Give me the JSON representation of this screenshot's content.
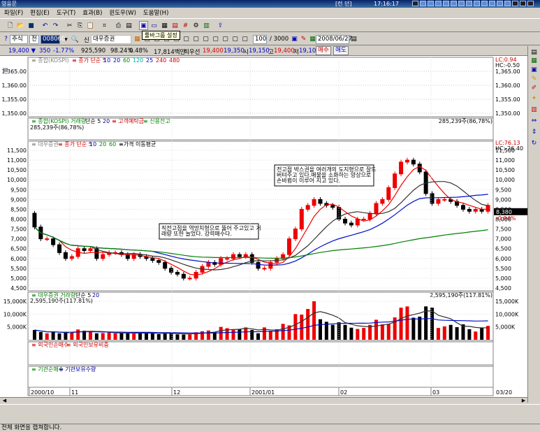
{
  "window": {
    "title": "영웅문",
    "status": "[런 던]",
    "clock": "17:16:17"
  },
  "menu": [
    "파일(F)",
    "편집(E)",
    "도구(T)",
    "효과(B)",
    "윈도우(W)",
    "도움말(H)"
  ],
  "tooltip": "툴바그룹 설정",
  "controls": {
    "market": "주식",
    "period": "전",
    "code": "008060",
    "flag": "신",
    "name": "대우증권",
    "count": "100",
    "total": "/ 3000",
    "date": "2008/06/27"
  },
  "info": {
    "price": "19,400 ▼",
    "change": "350",
    "change_pct": "-1.77%",
    "volume": "925,590",
    "vol_pct": "98.24%",
    "vol_change": "0.48%",
    "amount": "17,814백만",
    "low_label": "최우선",
    "best_bid": "19,400",
    "best_ask": "19,350",
    "open_label": "시",
    "open": "19,150",
    "high_label": "고",
    "high": "19,400",
    "lowp_label": "저",
    "lowp": "19,100",
    "buy": "매수",
    "sell": "매도"
  },
  "panels": {
    "kospi_title_prefix": "종합(KOSPI)",
    "kospi_ma": "종가 단순 5",
    "kospi_ma_periods": [
      "10",
      "20",
      "60",
      "120",
      "25",
      "240",
      "480"
    ],
    "kospi_lc": "LC:0.94",
    "kospi_hc": "HC:-0.50",
    "kospi_ticks": [
      "1,365.00",
      "1,360.00",
      "1,355.00",
      "1,350.00"
    ],
    "kvol_title": "종합(KOSPI) 거래량",
    "kvol_ma": "단순 5",
    "kvol_ma2": "20",
    "kvol_extra1": "고객예탁금",
    "kvol_extra2": "신용잔고",
    "kvol_value_left": "285,239주(86,78%)",
    "kvol_value_right": "285,239주(86,78%)",
    "main_title": "대우증권",
    "main_ma": "종가 단순 5",
    "main_ma_periods": [
      "10",
      "20",
      "60"
    ],
    "main_ma_extra": "가격 이동평균",
    "main_lc": "LC:76.13",
    "main_hc": "HC:-26.40",
    "main_price_box": "8,380",
    "main_price_pct": "-0.94%",
    "note1": "전고점 박스권을 여러개의 도지형으로 잘도 버텨주고 있다.매물을 소화하는 양상으로 손바뀜이 이루어 지고 있다.",
    "note2": "직전고점을 역망치형으로 뚫어 주고있고 거래량 또한 늘었다. 강력매수다.",
    "vol_title": "대우증권 거래량",
    "vol_ma": "단순 5",
    "vol_ma2": "20",
    "vol_value_left": "2,595,190주(117.81%)",
    "vol_value_right": "2,595,190주(117.81%)",
    "foreign_title": "외국인순매수",
    "foreign_title2": "외국인보유비중",
    "inst_title": "기관순매수",
    "inst_title2": "기관보유수량",
    "x_labels": [
      "2000/10",
      "11",
      "12",
      "2001/01",
      "02",
      "03"
    ],
    "last_date": "03/20"
  },
  "chart_data": {
    "type": "candlestick",
    "price_ticks": [
      "11,500",
      "11,000",
      "10,500",
      "10,000",
      "9,500",
      "9,000",
      "8,500",
      "8,000",
      "7,500",
      "7,000",
      "6,500",
      "6,000",
      "5,500",
      "5,000",
      "4,500"
    ],
    "price_range": [
      4500,
      11500
    ],
    "volume_ticks": [
      "15,000K",
      "10,000K",
      "5,000K"
    ],
    "volume_range": [
      0,
      18000
    ],
    "open": [
      8300,
      7600,
      7000,
      7000,
      6700,
      6300,
      6000,
      6100,
      6500,
      6400,
      6500,
      6000,
      6200,
      6300,
      6300,
      6200,
      6000,
      6200,
      6100,
      6000,
      5900,
      5800,
      5500,
      5300,
      5200,
      5000,
      5000,
      5300,
      5600,
      5800,
      5700,
      6000,
      6000,
      6200,
      6100,
      6200,
      5800,
      5500,
      5500,
      5800,
      6000,
      6200,
      7000,
      7500,
      8500,
      8700,
      9000,
      8800,
      8700,
      8600,
      8000,
      7800,
      7700,
      8000,
      8000,
      8300,
      8800,
      9000,
      9600,
      10300,
      10900,
      11000,
      10800,
      10400,
      9300,
      8800,
      9000,
      9000,
      8900,
      8700,
      8500,
      8400,
      8500,
      8400
    ],
    "close": [
      7600,
      7000,
      7000,
      6700,
      6300,
      6000,
      6100,
      6500,
      6400,
      6500,
      6000,
      6200,
      6300,
      6300,
      6200,
      6000,
      6200,
      6100,
      6000,
      5900,
      5800,
      5500,
      5300,
      5200,
      5000,
      5000,
      5300,
      5600,
      5800,
      5700,
      6000,
      6000,
      6200,
      6100,
      6200,
      5800,
      5500,
      5500,
      5800,
      6000,
      6200,
      7000,
      7500,
      8500,
      8700,
      9000,
      8800,
      8700,
      8600,
      8000,
      7800,
      7700,
      8000,
      8000,
      8300,
      8800,
      9000,
      9600,
      10300,
      10900,
      11000,
      10800,
      10400,
      9300,
      8800,
      9000,
      9000,
      8900,
      8700,
      8500,
      8400,
      8500,
      8400,
      8700
    ],
    "volume": [
      3800,
      3000,
      2500,
      3000,
      2500,
      2800,
      3000,
      4000,
      3500,
      3200,
      2500,
      2600,
      2800,
      2500,
      2700,
      2500,
      2400,
      2800,
      2600,
      2500,
      2200,
      2400,
      2800,
      2100,
      2000,
      2100,
      2900,
      3300,
      3600,
      3000,
      5000,
      4500,
      3800,
      4200,
      4800,
      3800,
      2500,
      4800,
      3500,
      4100,
      6200,
      5600,
      10000,
      9800,
      12000,
      15000,
      8000,
      7000,
      5800,
      6800,
      5800,
      4700,
      4200,
      4600,
      5800,
      7800,
      6000,
      6200,
      8700,
      12500,
      13000,
      8600,
      9000,
      13000,
      12500,
      4600,
      5200,
      5800,
      4900,
      6000,
      4100,
      3200,
      4800,
      5400
    ]
  },
  "toolbar_right": {
    "zoom_minus": "−",
    "zoom_plus": "+",
    "fit": "A"
  },
  "statusbar": "전체 화면을 캡쳐합니다."
}
